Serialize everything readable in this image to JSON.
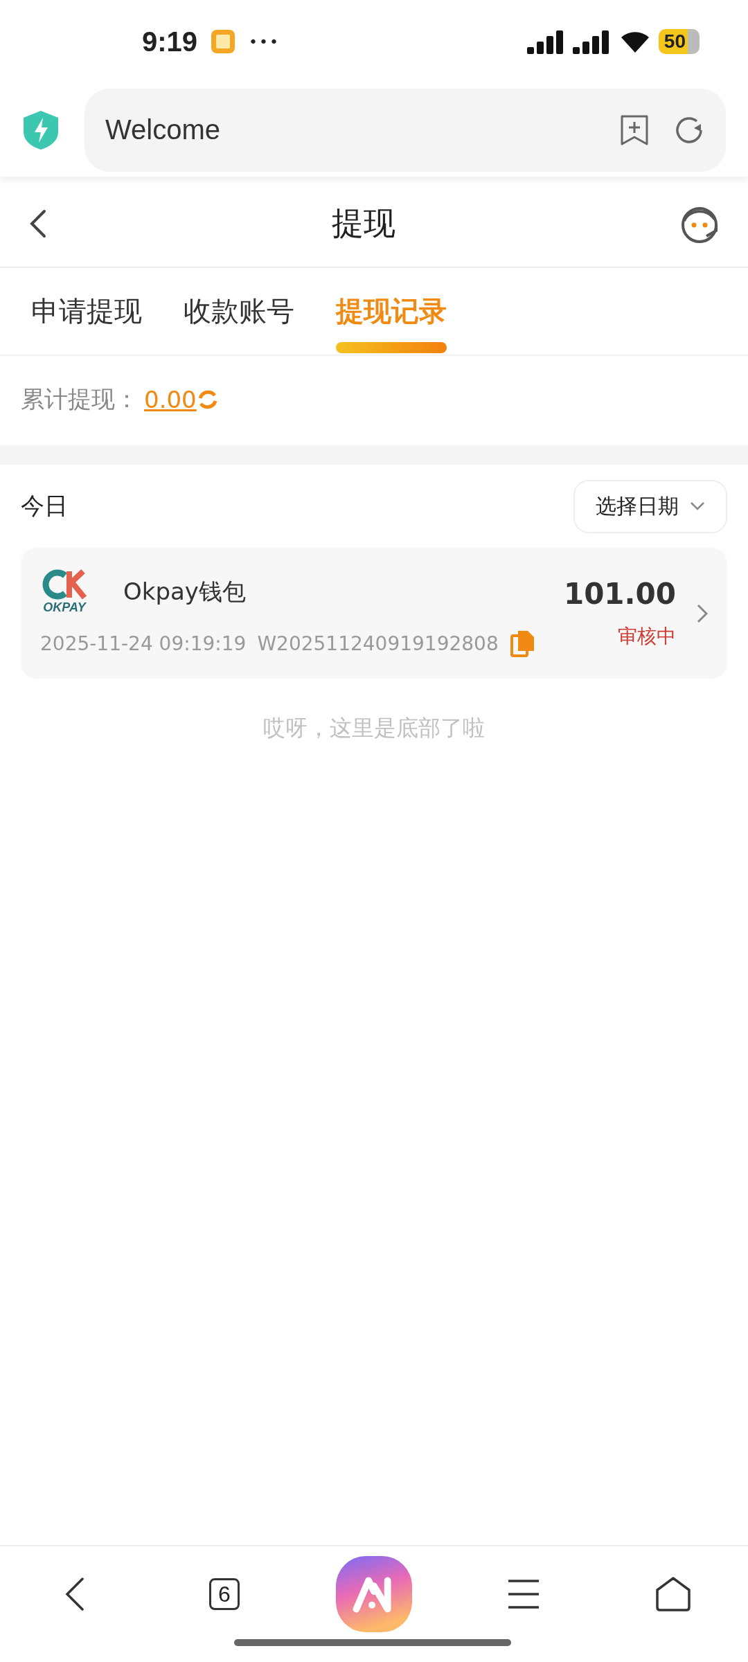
{
  "status_bar": {
    "time": "9:19",
    "more": "•••",
    "battery": "50"
  },
  "browser_bar": {
    "address": "Welcome"
  },
  "header": {
    "title": "提现"
  },
  "tabs": [
    {
      "label": "申请提现",
      "selected": false
    },
    {
      "label": "收款账号",
      "selected": false
    },
    {
      "label": "提现记录",
      "selected": true
    }
  ],
  "summary": {
    "label": "累计提现：",
    "amount": "0.00"
  },
  "section": {
    "title": "今日",
    "date_picker": "选择日期"
  },
  "records": [
    {
      "logo_text": "OKPAY",
      "name": "Okpay钱包",
      "amount": "101.00",
      "status": "审核中",
      "time": "2025-11-24 09:19:19",
      "order_no": "W202511240919192808"
    }
  ],
  "footer": "哎呀，这里是底部了啦",
  "bottom_nav": {
    "tabs_count": "6"
  }
}
